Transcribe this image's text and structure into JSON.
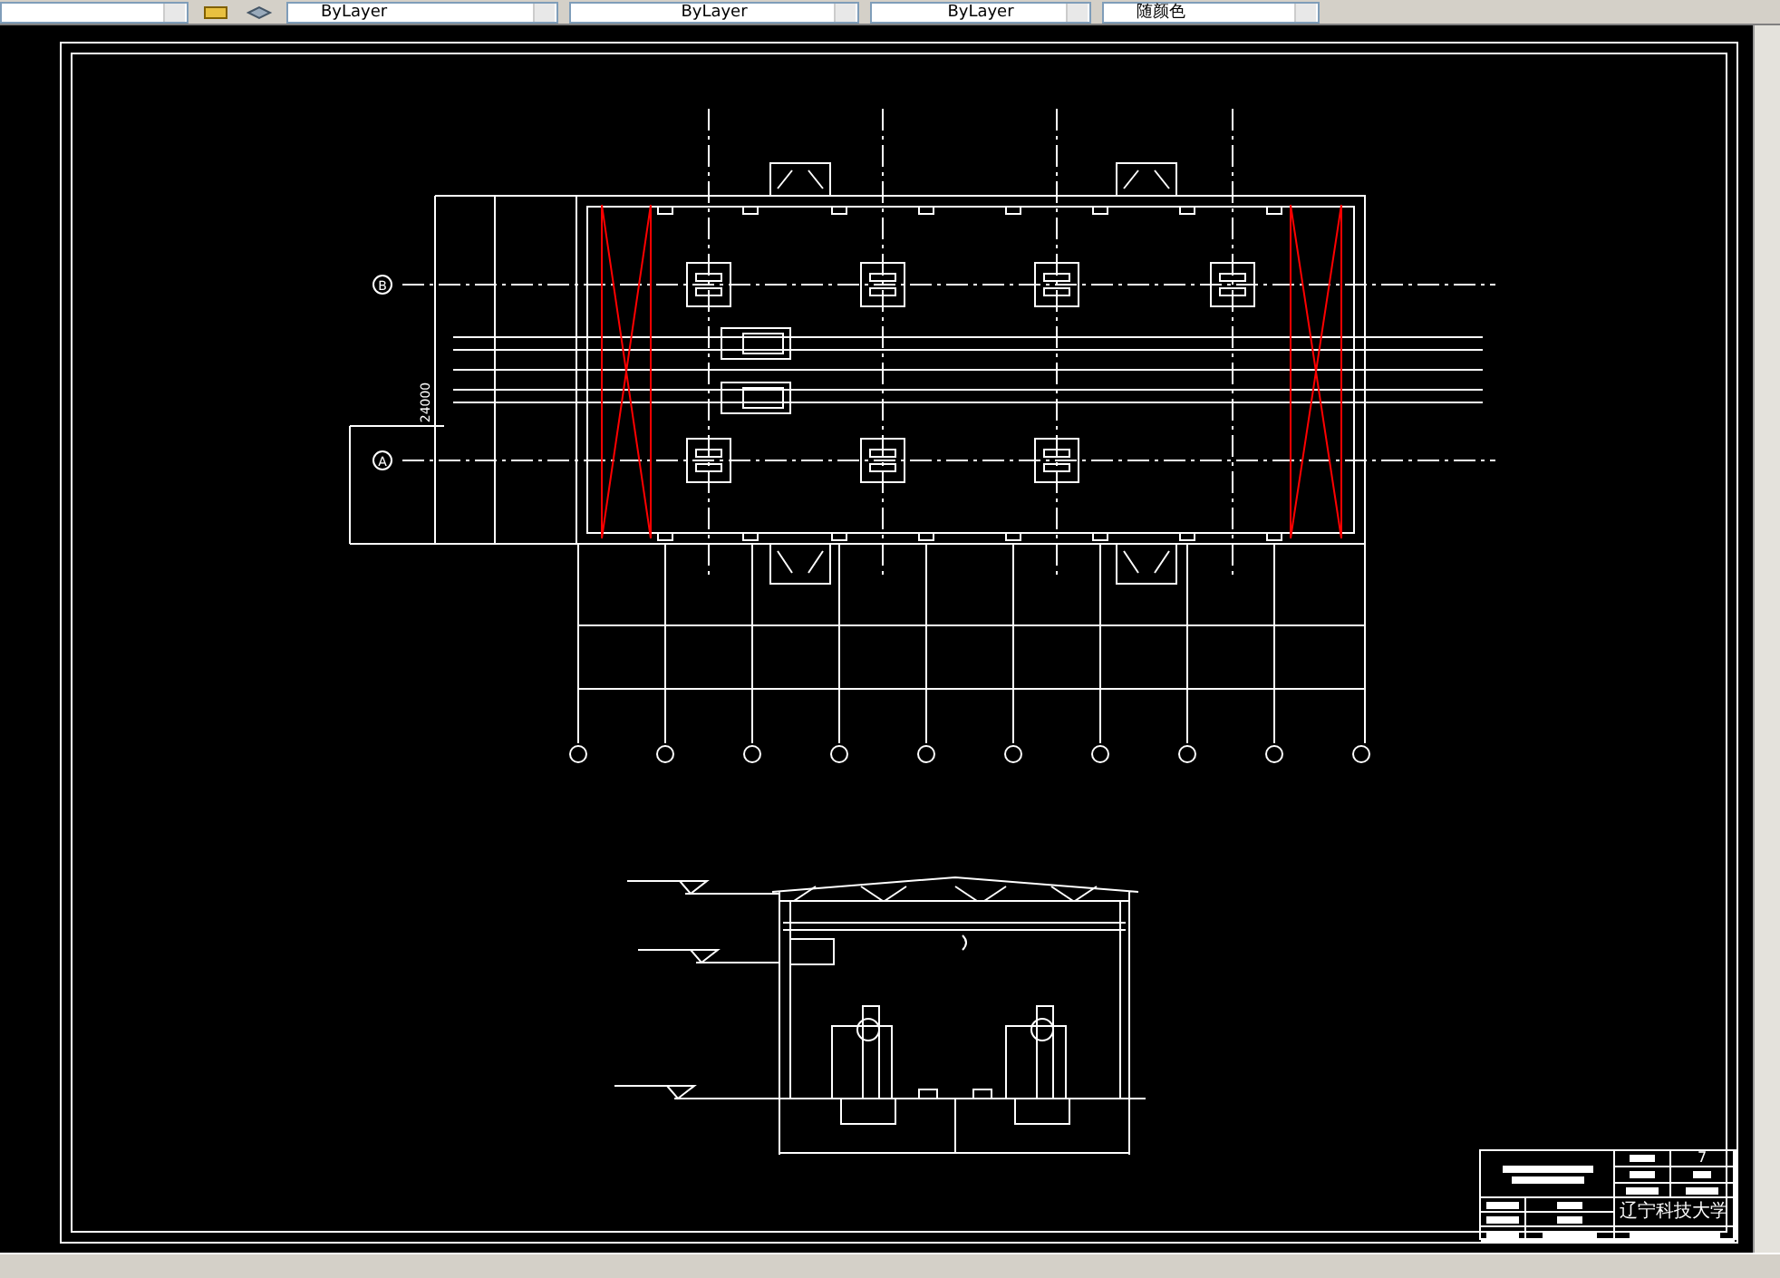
{
  "toolbar": {
    "dropdowns": [
      {
        "value": "ByLayer"
      },
      {
        "value": "ByLayer"
      },
      {
        "value": "ByLayer"
      },
      {
        "value": "随颜色"
      }
    ]
  },
  "plan": {
    "grid_bubbles": [
      "B",
      "A"
    ],
    "dimension": "24000"
  },
  "title_block": {
    "sheet_number": "7",
    "school": "辽宁科技大学"
  }
}
